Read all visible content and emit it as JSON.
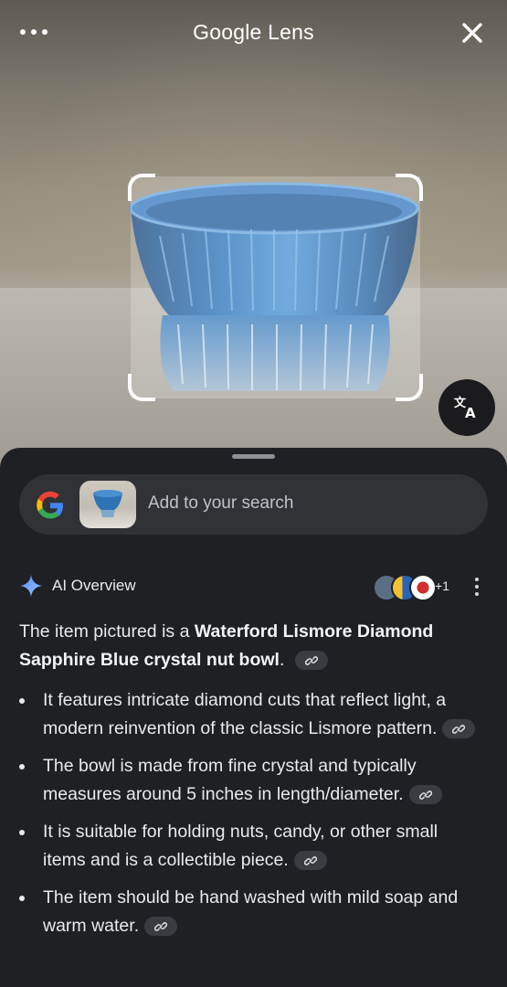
{
  "header": {
    "title": "Google Lens",
    "menu_icon": "more-horiz-icon",
    "close_icon": "close-icon"
  },
  "photo": {
    "subject": "blue crystal bowl",
    "translate_icon": "translate-icon"
  },
  "search": {
    "placeholder": "Add to your search",
    "logo_icon": "google-g-icon"
  },
  "ai_overview": {
    "title": "AI Overview",
    "sources_more": "+1",
    "summary_prefix": "The item pictured is a ",
    "summary_bold": "Waterford Lismore Diamond Sapphire Blue crystal nut bowl",
    "summary_suffix": ".",
    "bullets": [
      "It features intricate diamond cuts that reflect light, a modern reinvention of the classic Lismore pattern.",
      "The bowl is made from fine crystal and typically measures around 5 inches in length/diameter.",
      "It is suitable for holding nuts, candy, or other small items and is a collectible piece.",
      "The item should be hand washed with mild soap and warm water."
    ]
  },
  "colors": {
    "sheet_bg": "#1f2023",
    "search_bg": "#303236",
    "bowl_blue": "#2a6fb0"
  }
}
